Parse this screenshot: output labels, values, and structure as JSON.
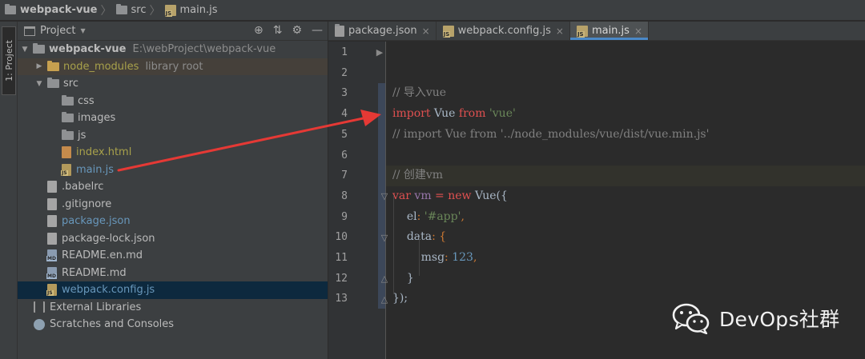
{
  "breadcrumb": {
    "items": [
      {
        "label": "webpack-vue",
        "icon": "folder-icon"
      },
      {
        "label": "src",
        "icon": "folder-icon"
      },
      {
        "label": "main.js",
        "icon": "js-file-icon"
      }
    ]
  },
  "left_stripe": {
    "label": "1: Project"
  },
  "project_panel": {
    "title": "Project",
    "tree": [
      {
        "label": "webpack-vue",
        "extra": "E:\\webProject\\webpack-vue",
        "depth": 0,
        "arrow": "▼",
        "icon": "folder"
      },
      {
        "label": "node_modules",
        "extra": "library root",
        "depth": 1,
        "arrow": "▶",
        "icon": "folder-orange"
      },
      {
        "label": "src",
        "extra": "",
        "depth": 1,
        "arrow": "▼",
        "icon": "folder"
      },
      {
        "label": "css",
        "extra": "",
        "depth": 2,
        "arrow": "",
        "icon": "folder"
      },
      {
        "label": "images",
        "extra": "",
        "depth": 2,
        "arrow": "",
        "icon": "folder"
      },
      {
        "label": "js",
        "extra": "",
        "depth": 2,
        "arrow": "",
        "icon": "folder"
      },
      {
        "label": "index.html",
        "extra": "",
        "depth": 2,
        "arrow": "",
        "icon": "html"
      },
      {
        "label": "main.js",
        "extra": "",
        "depth": 2,
        "arrow": "",
        "icon": "js"
      },
      {
        "label": ".babelrc",
        "extra": "",
        "depth": 1,
        "arrow": "",
        "icon": "cfg"
      },
      {
        "label": ".gitignore",
        "extra": "",
        "depth": 1,
        "arrow": "",
        "icon": "cfg"
      },
      {
        "label": "package.json",
        "extra": "",
        "depth": 1,
        "arrow": "",
        "icon": "cfg"
      },
      {
        "label": "package-lock.json",
        "extra": "",
        "depth": 1,
        "arrow": "",
        "icon": "cfg"
      },
      {
        "label": "README.en.md",
        "extra": "",
        "depth": 1,
        "arrow": "",
        "icon": "md"
      },
      {
        "label": "README.md",
        "extra": "",
        "depth": 1,
        "arrow": "",
        "icon": "md"
      },
      {
        "label": "webpack.config.js",
        "extra": "",
        "depth": 1,
        "arrow": "",
        "icon": "js"
      },
      {
        "label": "External Libraries",
        "extra": "",
        "depth": 0,
        "arrow": "",
        "icon": "lib"
      },
      {
        "label": "Scratches and Consoles",
        "extra": "",
        "depth": 0,
        "arrow": "",
        "icon": "scratch"
      }
    ]
  },
  "tabs": [
    {
      "label": "package.json",
      "close": "×",
      "active": false
    },
    {
      "label": "webpack.config.js",
      "close": "×",
      "active": false
    },
    {
      "label": "main.js",
      "close": "×",
      "active": true
    }
  ],
  "editor": {
    "line_numbers": [
      "1",
      "2",
      "3",
      "4",
      "5",
      "6",
      "7",
      "8",
      "9",
      "10",
      "11",
      "12",
      "13"
    ],
    "lines": {
      "l3": "// 导入vue",
      "l4_kw": "import",
      "l4_id": " Vue ",
      "l4_from": "from",
      "l4_str": " 'vue'",
      "l5": "// import Vue from '../node_modules/vue/dist/vue.min.js'",
      "l7": "// 创建vm",
      "l8_var": "var",
      "l8_id": " vm ",
      "l8_eq": "= ",
      "l8_new": "new",
      "l8_rest": " Vue({",
      "l9_prop": "el",
      "l9_colon": ": ",
      "l9_str": "'#app'",
      "l9_comma": ",",
      "l10_prop": "data",
      "l10_rest": ": {",
      "l11_prop": "msg",
      "l11_colon": ": ",
      "l11_num": "123",
      "l11_comma": ",",
      "l12": "}",
      "l13": "});"
    }
  },
  "watermark": {
    "text": "DevOps社群"
  },
  "colors": {
    "keyword": "#cc7832",
    "string": "#6a8759",
    "comment": "#808080",
    "number": "#6897bb",
    "property": "#9876aa",
    "annotation_arrow": "#e53935",
    "active_tab": "#4a88c7"
  }
}
